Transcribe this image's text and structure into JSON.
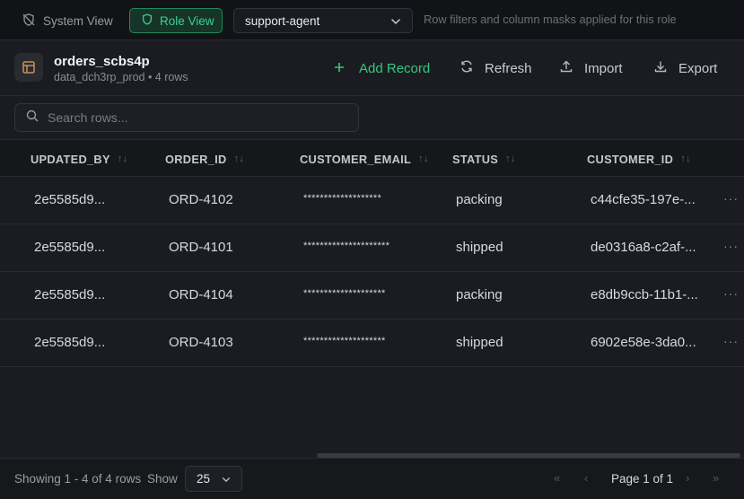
{
  "topbar": {
    "system_view_label": "System View",
    "role_view_label": "Role View",
    "role_selected": "support-agent",
    "hint": "Row filters and column masks applied for this role"
  },
  "table_header": {
    "name": "orders_scbs4p",
    "meta": "data_dch3rp_prod • 4 rows"
  },
  "actions": {
    "add_label": "Add Record",
    "refresh_label": "Refresh",
    "import_label": "Import",
    "export_label": "Export"
  },
  "search": {
    "placeholder": "Search rows..."
  },
  "columns": [
    "UPDATED_BY",
    "ORDER_ID",
    "CUSTOMER_EMAIL",
    "STATUS",
    "CUSTOMER_ID"
  ],
  "rows": [
    [
      "2e5585d9...",
      "ORD-4102",
      "*******************",
      "packing",
      "c44cfe35-197e-..."
    ],
    [
      "2e5585d9...",
      "ORD-4101",
      "*********************",
      "shipped",
      "de0316a8-c2af-..."
    ],
    [
      "2e5585d9...",
      "ORD-4104",
      "********************",
      "packing",
      "e8db9ccb-11b1-..."
    ],
    [
      "2e5585d9...",
      "ORD-4103",
      "********************",
      "shipped",
      "6902e58e-3da0..."
    ]
  ],
  "footer": {
    "showing": "Showing 1 - 4 of 4 rows",
    "show_label": "Show",
    "page_size": "25",
    "page_info": "Page 1 of 1"
  },
  "colors": {
    "accent_green": "#34c77f",
    "background": "#1b1c21",
    "topbar": "#121316"
  },
  "icons": [
    "shield-off-icon",
    "shield-icon",
    "chevron-down-icon",
    "table-icon",
    "plus-icon",
    "refresh-icon",
    "upload-icon",
    "download-icon",
    "search-icon",
    "sort-icon",
    "more-icon",
    "first-page-icon",
    "prev-page-icon",
    "next-page-icon",
    "last-page-icon"
  ]
}
